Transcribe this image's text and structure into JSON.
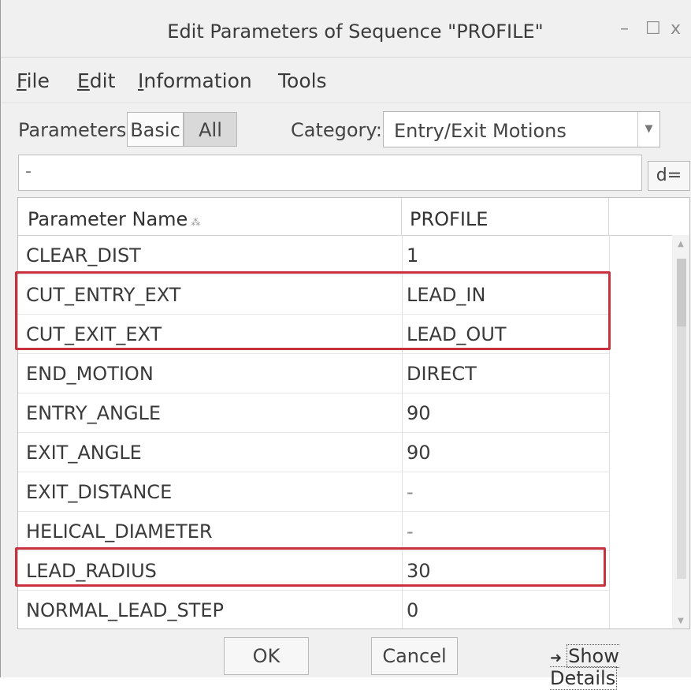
{
  "window": {
    "title": "Edit Parameters of Sequence \"PROFILE\"",
    "controls": {
      "minimize": "–",
      "maximize": "☐",
      "close": "x"
    }
  },
  "menu": {
    "items": [
      {
        "first": "F",
        "rest": "ile"
      },
      {
        "first": "E",
        "rest": "dit"
      },
      {
        "first": "I",
        "rest": "nformation"
      },
      {
        "first": "",
        "rest": "Tools"
      }
    ]
  },
  "toolbar": {
    "parameters_label": "Parameters",
    "basic_label": "Basic",
    "all_label": "All",
    "category_label": "Category:",
    "category_value": "Entry/Exit Motions"
  },
  "expression": {
    "value": "-",
    "d_button": "d="
  },
  "table": {
    "headers": [
      "Parameter Name",
      "PROFILE"
    ],
    "rows": [
      {
        "name": "CLEAR_DIST",
        "value": "1"
      },
      {
        "name": "CUT_ENTRY_EXT",
        "value": "LEAD_IN"
      },
      {
        "name": "CUT_EXIT_EXT",
        "value": "LEAD_OUT"
      },
      {
        "name": "END_MOTION",
        "value": "DIRECT"
      },
      {
        "name": "ENTRY_ANGLE",
        "value": "90"
      },
      {
        "name": "EXIT_ANGLE",
        "value": "90"
      },
      {
        "name": "EXIT_DISTANCE",
        "value": "-"
      },
      {
        "name": "HELICAL_DIAMETER",
        "value": "-"
      },
      {
        "name": "LEAD_RADIUS",
        "value": "30"
      },
      {
        "name": "NORMAL_LEAD_STEP",
        "value": "0"
      }
    ],
    "highlight_color": "#c8323e"
  },
  "footer": {
    "ok_label": "OK",
    "cancel_label": "Cancel",
    "show_details_label": "Show Details"
  }
}
